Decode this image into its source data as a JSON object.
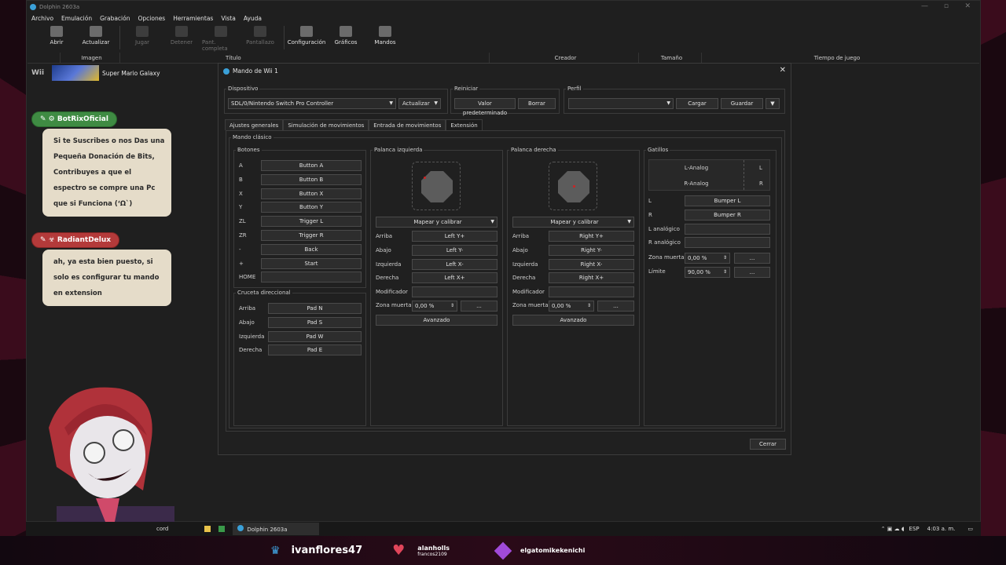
{
  "window": {
    "title": "Dolphin 2603a",
    "menu": [
      "Archivo",
      "Emulación",
      "Grabación",
      "Opciones",
      "Herramientas",
      "Vista",
      "Ayuda"
    ],
    "toolbar": [
      {
        "label": "Abrir",
        "enabled": true
      },
      {
        "label": "Actualizar",
        "enabled": true
      },
      {
        "label": "Jugar",
        "enabled": false
      },
      {
        "label": "Detener",
        "enabled": false
      },
      {
        "label": "Pant. completa",
        "enabled": false
      },
      {
        "label": "Pantallazo",
        "enabled": false
      },
      {
        "label": "Configuración",
        "enabled": true
      },
      {
        "label": "Gráficos",
        "enabled": true
      },
      {
        "label": "Mandos",
        "enabled": true
      }
    ],
    "columns": {
      "image": "Imagen",
      "title": "Título",
      "creator": "Creador",
      "size": "Tamaño",
      "playtime": "Tiempo de juego"
    },
    "game": {
      "platform": "Wii",
      "title": "Super Mario Galaxy"
    }
  },
  "chat": [
    {
      "name": "BotRixOficial",
      "color": "#3f8b43",
      "message": "Si te Suscribes o nos Das una Pequeña Donación de Bits, Contribuyes a que el espectro se compre una Pc que si Funciona (ʻΩ`)"
    },
    {
      "name": "RadiantDelux",
      "color": "#b43a3a",
      "message": "ah, ya esta bien puesto, si solo es configurar tu mando en extension"
    }
  ],
  "dialog": {
    "title": "Mando de Wii 1",
    "device_label": "Dispositivo",
    "device_value": "SDL/0/Nintendo Switch Pro Controller",
    "refresh": "Actualizar",
    "reset_label": "Reiniciar",
    "default": "Valor predeterminado",
    "clear": "Borrar",
    "profile_label": "Perfil",
    "load": "Cargar",
    "save": "Guardar",
    "tabs": [
      "Ajustes generales",
      "Simulación de movimientos",
      "Entrada de movimientos",
      "Extensión"
    ],
    "active_tab": "Extensión",
    "extension_group": "Mando clásico",
    "buttons_group": "Botones",
    "buttons": [
      {
        "label": "A",
        "value": "Button A"
      },
      {
        "label": "B",
        "value": "Button B"
      },
      {
        "label": "X",
        "value": "Button X"
      },
      {
        "label": "Y",
        "value": "Button Y"
      },
      {
        "label": "ZL",
        "value": "Trigger L"
      },
      {
        "label": "ZR",
        "value": "Trigger R"
      },
      {
        "label": "-",
        "value": "Back"
      },
      {
        "label": "+",
        "value": "Start"
      },
      {
        "label": "HOME",
        "value": ""
      }
    ],
    "dpad_group": "Cruceta direccional",
    "dpad": [
      {
        "label": "Arriba",
        "value": "Pad N"
      },
      {
        "label": "Abajo",
        "value": "Pad S"
      },
      {
        "label": "Izquierda",
        "value": "Pad W"
      },
      {
        "label": "Derecha",
        "value": "Pad E"
      }
    ],
    "left_stick": {
      "group": "Palanca izquierda",
      "map": "Mapear y calibrar",
      "rows": [
        {
          "label": "Arriba",
          "value": "Left Y+"
        },
        {
          "label": "Abajo",
          "value": "Left Y-"
        },
        {
          "label": "Izquierda",
          "value": "Left X-"
        },
        {
          "label": "Derecha",
          "value": "Left X+"
        },
        {
          "label": "Modificador",
          "value": ""
        }
      ],
      "deadzone_label": "Zona muerta",
      "deadzone": "0,00 %",
      "more": "...",
      "advanced": "Avanzado"
    },
    "right_stick": {
      "group": "Palanca derecha",
      "map": "Mapear y calibrar",
      "rows": [
        {
          "label": "Arriba",
          "value": "Right Y+"
        },
        {
          "label": "Abajo",
          "value": "Right Y-"
        },
        {
          "label": "Izquierda",
          "value": "Right X-"
        },
        {
          "label": "Derecha",
          "value": "Right X+"
        },
        {
          "label": "Modificador",
          "value": ""
        }
      ],
      "deadzone_label": "Zona muerta",
      "deadzone": "0,00 %",
      "more": "...",
      "advanced": "Avanzado"
    },
    "triggers": {
      "group": "Gatillos",
      "analog": [
        {
          "label": "L-Analog",
          "key": "L"
        },
        {
          "label": "R-Analog",
          "key": "R"
        }
      ],
      "rows": [
        {
          "label": "L",
          "value": "Bumper L"
        },
        {
          "label": "R",
          "value": "Bumper R"
        },
        {
          "label": "L analógico",
          "value": ""
        },
        {
          "label": "R analógico",
          "value": ""
        }
      ],
      "deadzone_label": "Zona muerta",
      "deadzone": "0,00 %",
      "limit_label": "Límite",
      "limit": "90,00 %",
      "more": "..."
    },
    "close": "Cerrar"
  },
  "taskbar": {
    "item1": "cord",
    "item2": "Dolphin 2603a",
    "lang": "ESP",
    "time": "4:03 a. m."
  },
  "stream": {
    "name": "ivanflores47",
    "user1": "alanholls",
    "user1_sub": "francos2109",
    "user2": "elgatomikekenichi"
  }
}
